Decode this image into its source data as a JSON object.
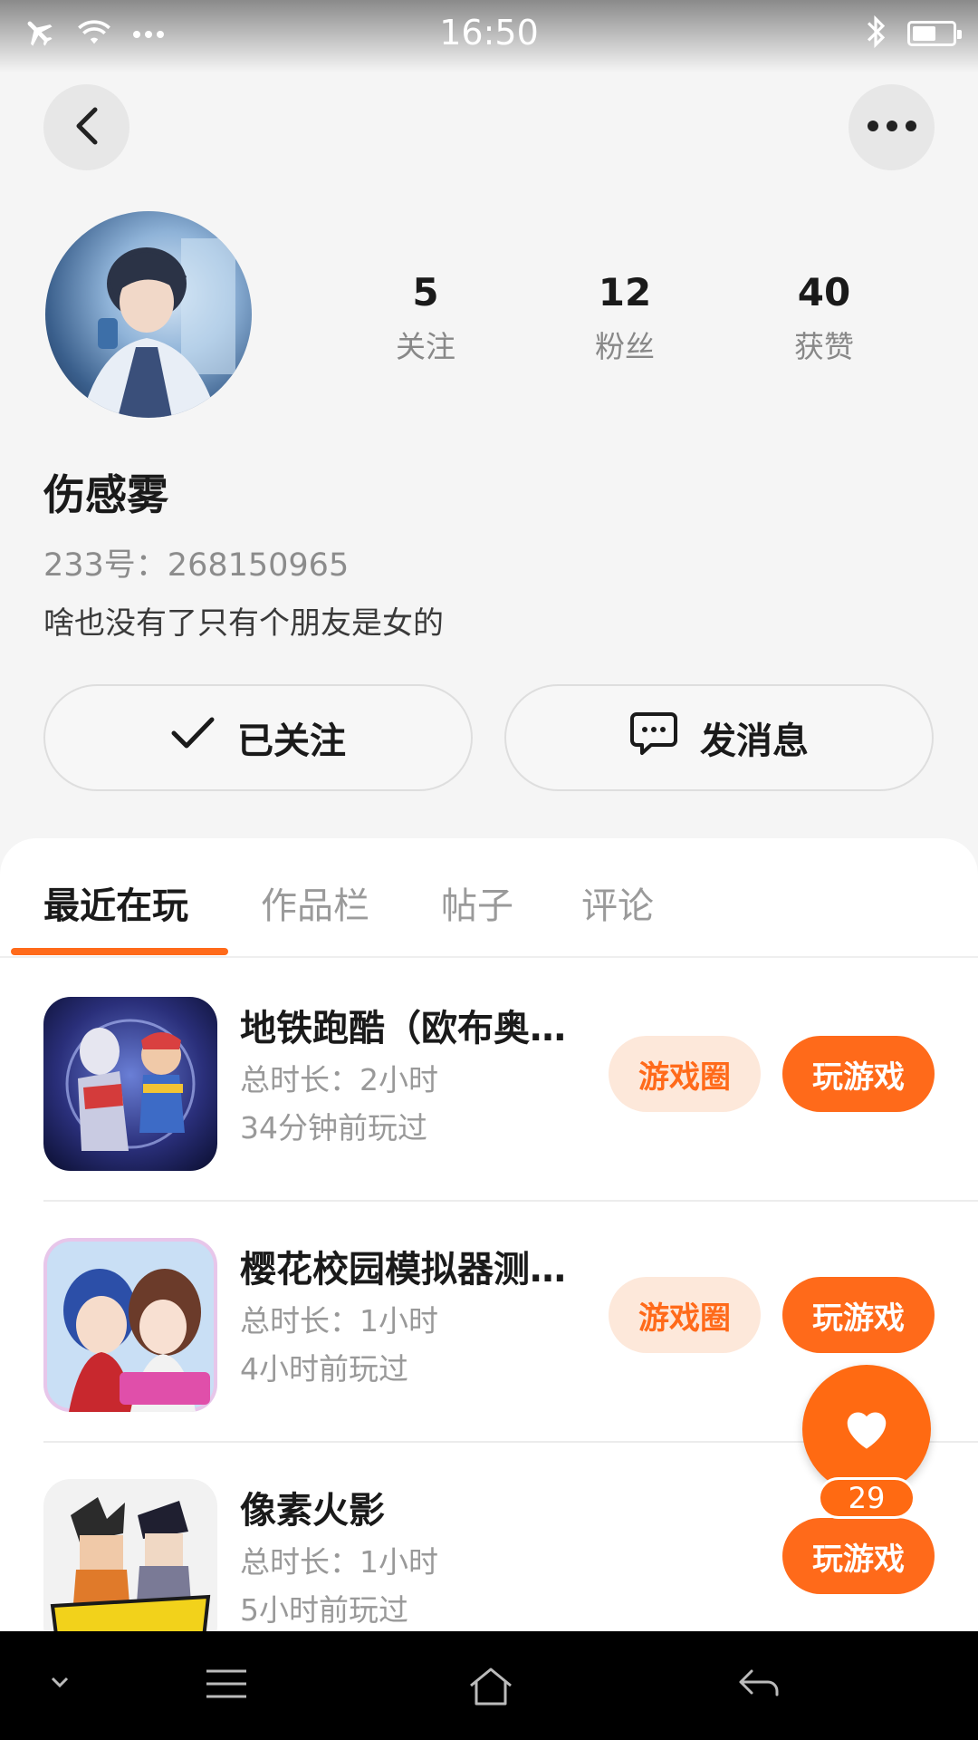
{
  "status_bar": {
    "time": "16:50",
    "icons": [
      "airplane-icon",
      "wifi-icon",
      "more-dots-icon",
      "bluetooth-icon",
      "battery-icon"
    ],
    "battery_level": 0.6
  },
  "header": {
    "back_icon": "chevron-left-icon",
    "more_icon": "more-horizontal-icon"
  },
  "profile": {
    "name": "伤感雾",
    "id_text": "233号：268150965",
    "bio": "啥也没有了只有个朋友是女的",
    "stats": [
      {
        "value": "5",
        "label": "关注"
      },
      {
        "value": "12",
        "label": "粉丝"
      },
      {
        "value": "40",
        "label": "获赞"
      }
    ]
  },
  "actions": {
    "follow_label": "已关注",
    "message_label": "发消息"
  },
  "tabs": [
    {
      "label": "最近在玩",
      "active": true
    },
    {
      "label": "作品栏",
      "active": false
    },
    {
      "label": "帖子",
      "active": false
    },
    {
      "label": "评论",
      "active": false
    }
  ],
  "games": [
    {
      "title": "地铁跑酷（欧布奥特曼版）",
      "duration": "总时长：2小时",
      "last_played": "34分钟前玩过",
      "circle_label": "游戏圈",
      "play_label": "玩游戏"
    },
    {
      "title": "樱花校园模拟器测试版",
      "duration": "总时长：1小时",
      "last_played": "4小时前玩过",
      "circle_label": "游戏圈",
      "play_label": "玩游戏"
    },
    {
      "title": "像素火影",
      "duration": "总时长：1小时",
      "last_played": "5小时前玩过",
      "play_label": "玩游戏"
    }
  ],
  "fab": {
    "icon": "heart-icon",
    "count": "29"
  },
  "nav_bar": {
    "icons": [
      "chevron-down-icon",
      "menu-icon",
      "home-icon",
      "back-arrow-icon"
    ]
  },
  "colors": {
    "accent": "#ff6a1a",
    "accent_light": "#fde8da"
  }
}
